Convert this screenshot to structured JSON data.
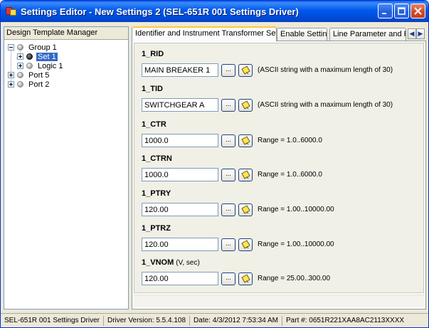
{
  "window": {
    "title": "Settings Editor - New Settings 2 (SEL-651R 001 Settings Driver)"
  },
  "left_panel": {
    "header": "Design Template Manager",
    "tree": [
      {
        "label": "Group 1",
        "expander": "minus",
        "dot": "grey",
        "selected": false
      },
      {
        "label": "Set 1",
        "expander": "plus",
        "dot": "dark",
        "selected": true
      },
      {
        "label": "Logic 1",
        "expander": "plus",
        "dot": "grey",
        "selected": false
      },
      {
        "label": "Port 5",
        "expander": "plus",
        "dot": "grey",
        "selected": false
      },
      {
        "label": "Port 2",
        "expander": "plus",
        "dot": "grey",
        "selected": false
      }
    ]
  },
  "tabs": [
    {
      "label": "Identifier and Instrument Transformer Settings",
      "active": true
    },
    {
      "label": "Enable Settings",
      "active": false
    },
    {
      "label": "Line Parameter and Fault",
      "active": false
    }
  ],
  "settings": [
    {
      "name": "1_RID",
      "unit": "",
      "value": "MAIN BREAKER 1",
      "hint": "(ASCII string with a maximum length of 30)"
    },
    {
      "name": "1_TID",
      "unit": "",
      "value": "SWITCHGEAR A",
      "hint": "(ASCII string with a maximum length of 30)"
    },
    {
      "name": "1_CTR",
      "unit": "",
      "value": "1000.0",
      "hint": "Range = 1.0..6000.0"
    },
    {
      "name": "1_CTRN",
      "unit": "",
      "value": "1000.0",
      "hint": "Range = 1.0..6000.0"
    },
    {
      "name": "1_PTRY",
      "unit": "",
      "value": "120.00",
      "hint": "Range = 1.00..10000.00"
    },
    {
      "name": "1_PTRZ",
      "unit": "",
      "value": "120.00",
      "hint": "Range = 1.00..10000.00"
    },
    {
      "name": "1_VNOM",
      "unit": "(V, sec)",
      "value": "120.00",
      "hint": "Range = 25.00..300.00"
    }
  ],
  "buttons": {
    "more_label": "..."
  },
  "statusbar": {
    "driver": "SEL-651R 001 Settings Driver",
    "version": "Driver Version: 5.5.4.108",
    "date": "Date: 4/3/2012 7:53:34 AM",
    "part": "Part #: 0651R221XAA8AC2113XXXX"
  },
  "colors": {
    "titlebar": "#0058ee",
    "selection": "#316ac5",
    "tab_highlight": "#ffc83c"
  }
}
